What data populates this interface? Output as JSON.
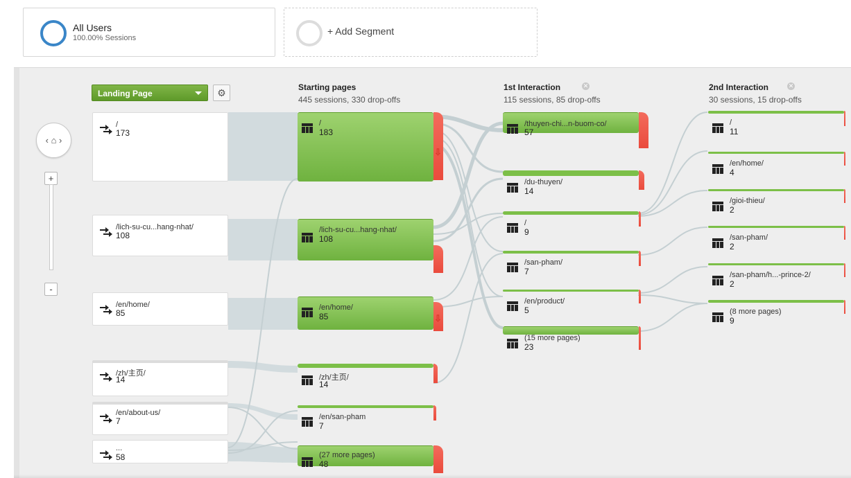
{
  "segments": {
    "all_users": {
      "title": "All Users",
      "subtitle": "100.00% Sessions"
    },
    "add": {
      "label": "+ Add Segment"
    }
  },
  "controls": {
    "dimension_dropdown": "Landing Page",
    "home_label": "‹ ⌂ ›",
    "zoom_in": "+",
    "zoom_out": "-"
  },
  "columns": [
    {
      "title": "Starting pages",
      "subtitle": "445 sessions, 330 drop-offs"
    },
    {
      "title": "1st Interaction",
      "subtitle": "115 sessions, 85 drop-offs"
    },
    {
      "title": "2nd Interaction",
      "subtitle": "30 sessions, 15 drop-offs"
    }
  ],
  "landing_pages": [
    {
      "name": "/",
      "count": "173"
    },
    {
      "name": "/lich-su-cu...hang-nhat/",
      "count": "108"
    },
    {
      "name": "/en/home/",
      "count": "85"
    },
    {
      "name": "/zh/主页/",
      "count": "14"
    },
    {
      "name": "/en/about-us/",
      "count": "7"
    },
    {
      "name": "...",
      "count": "58"
    }
  ],
  "starting_pages": [
    {
      "name": "/",
      "count": "183"
    },
    {
      "name": "/lich-su-cu...hang-nhat/",
      "count": "108"
    },
    {
      "name": "/en/home/",
      "count": "85"
    },
    {
      "name": "/zh/主页/",
      "count": "14"
    },
    {
      "name": "/en/san-pham",
      "count": "7"
    },
    {
      "name": "(27 more pages)",
      "count": "48"
    }
  ],
  "first_interaction": [
    {
      "name": "/thuyen-chi...n-buom-co/",
      "count": "57"
    },
    {
      "name": "/du-thuyen/",
      "count": "14"
    },
    {
      "name": "/",
      "count": "9"
    },
    {
      "name": "/san-pham/",
      "count": "7"
    },
    {
      "name": "/en/product/",
      "count": "5"
    },
    {
      "name": "(15 more pages)",
      "count": "23"
    }
  ],
  "second_interaction": [
    {
      "name": "/",
      "count": "11"
    },
    {
      "name": "/en/home/",
      "count": "4"
    },
    {
      "name": "/gioi-thieu/",
      "count": "2"
    },
    {
      "name": "/san-pham/",
      "count": "2"
    },
    {
      "name": "/san-pham/h...-prince-2/",
      "count": "2"
    },
    {
      "name": "(8 more pages)",
      "count": "9"
    }
  ],
  "colors": {
    "accent_blue": "#3a86c8",
    "node_green": "#7cbf48",
    "dropoff_red": "#ea4b3d",
    "flow_gray": "#c9d3d6",
    "canvas_bg": "#eeeeee"
  }
}
